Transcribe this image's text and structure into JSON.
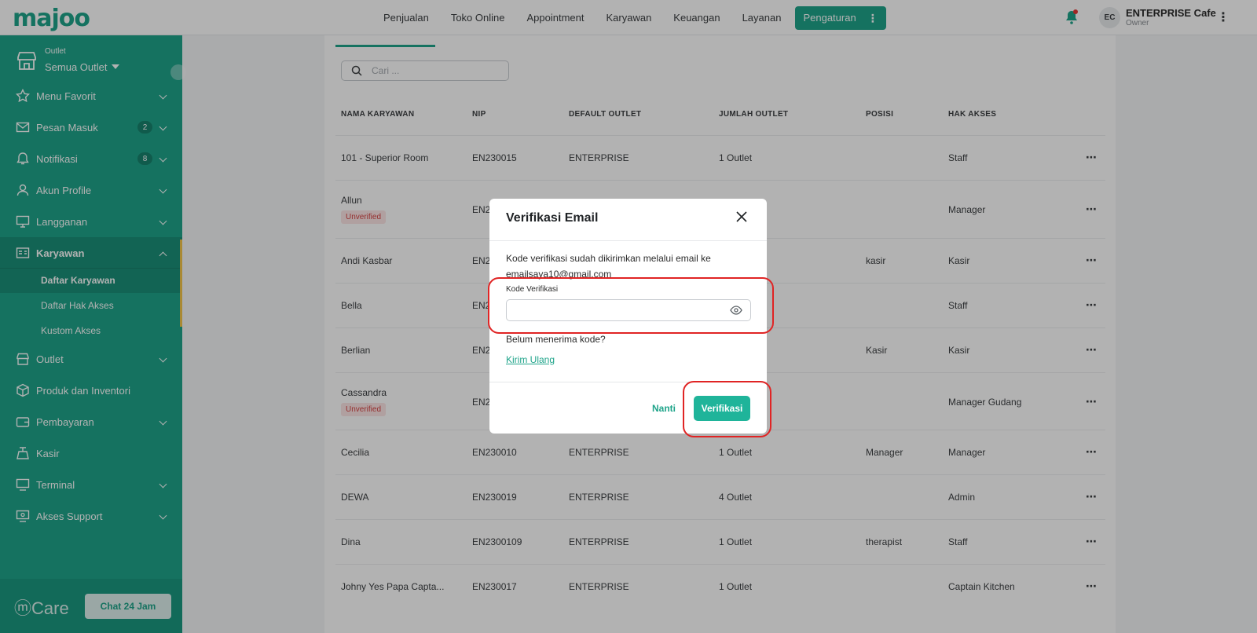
{
  "app": {
    "logo": "majoo",
    "nav": [
      "Penjualan",
      "Toko Online",
      "Appointment",
      "Karyawan",
      "Keuangan",
      "Layanan"
    ],
    "nav_active": "Pengaturan",
    "user": {
      "initials": "EC",
      "name": "ENTERPRISE Cafe",
      "role": "Owner"
    }
  },
  "sidebar": {
    "outlet_label": "Outlet",
    "outlet_value": "Semua Outlet",
    "items": [
      {
        "label": "Menu Favorit",
        "icon": "star-icon"
      },
      {
        "label": "Pesan Masuk",
        "icon": "mail-icon",
        "badge": "2"
      },
      {
        "label": "Notifikasi",
        "icon": "bell-icon",
        "badge": "8"
      },
      {
        "label": "Akun Profile",
        "icon": "user-icon"
      },
      {
        "label": "Langganan",
        "icon": "monitor-icon"
      },
      {
        "label": "Karyawan",
        "icon": "id-card-icon"
      },
      {
        "label": "Outlet",
        "icon": "store-icon"
      },
      {
        "label": "Produk dan Inventori",
        "icon": "box-icon"
      },
      {
        "label": "Pembayaran",
        "icon": "wallet-icon"
      },
      {
        "label": "Kasir",
        "icon": "cashier-icon"
      },
      {
        "label": "Terminal",
        "icon": "terminal-icon"
      },
      {
        "label": "Akses Support",
        "icon": "support-icon"
      }
    ],
    "submenu": [
      "Daftar Karyawan",
      "Daftar Hak Akses",
      "Kustom Akses"
    ],
    "care_logo": "Care",
    "care_button": "Chat 24 Jam"
  },
  "table": {
    "search_placeholder": "Cari ...",
    "headers": [
      "NAMA KARYAWAN",
      "NIP",
      "DEFAULT OUTLET",
      "JUMLAH OUTLET",
      "POSISI",
      "HAK AKSES"
    ],
    "rows": [
      {
        "name": "101 - Superior Room",
        "nip": "EN230015",
        "outlet": "ENTERPRISE",
        "count": "1 Outlet",
        "pos": "",
        "access": "Staff"
      },
      {
        "name": "Allun",
        "nip": "EN2",
        "outlet": "",
        "count": "",
        "pos": "",
        "access": "Manager",
        "status": "Unverified"
      },
      {
        "name": "Andi Kasbar",
        "nip": "EN2",
        "outlet": "",
        "count": "",
        "pos": "kasir",
        "access": "Kasir"
      },
      {
        "name": "Bella",
        "nip": "EN2",
        "outlet": "",
        "count": "",
        "pos": "",
        "access": "Staff"
      },
      {
        "name": "Berlian",
        "nip": "EN2",
        "outlet": "",
        "count": "",
        "pos": "Kasir",
        "access": "Kasir"
      },
      {
        "name": "Cassandra",
        "nip": "EN2",
        "outlet": "",
        "count": "",
        "pos": "",
        "access": "Manager Gudang",
        "status": "Unverified"
      },
      {
        "name": "Cecilia",
        "nip": "EN230010",
        "outlet": "ENTERPRISE",
        "count": "1 Outlet",
        "pos": "Manager",
        "access": "Manager"
      },
      {
        "name": "DEWA",
        "nip": "EN230019",
        "outlet": "ENTERPRISE",
        "count": "4 Outlet",
        "pos": "",
        "access": "Admin"
      },
      {
        "name": "Dina",
        "nip": "EN2300109",
        "outlet": "ENTERPRISE",
        "count": "1 Outlet",
        "pos": "therapist",
        "access": "Staff"
      },
      {
        "name": "Johny Yes Papa Capta...",
        "nip": "EN230017",
        "outlet": "ENTERPRISE",
        "count": "1 Outlet",
        "pos": "",
        "access": "Captain Kitchen"
      }
    ]
  },
  "modal": {
    "title": "Verifikasi Email",
    "message": "Kode verifikasi sudah dikirimkan melalui email ke emailsaya10@gmail.com",
    "field_label": "Kode Verifikasi",
    "field_value": "",
    "resend_question": "Belum menerima kode?",
    "resend_link": "Kirim Ulang",
    "later_button": "Nanti",
    "verify_button": "Verifikasi"
  }
}
